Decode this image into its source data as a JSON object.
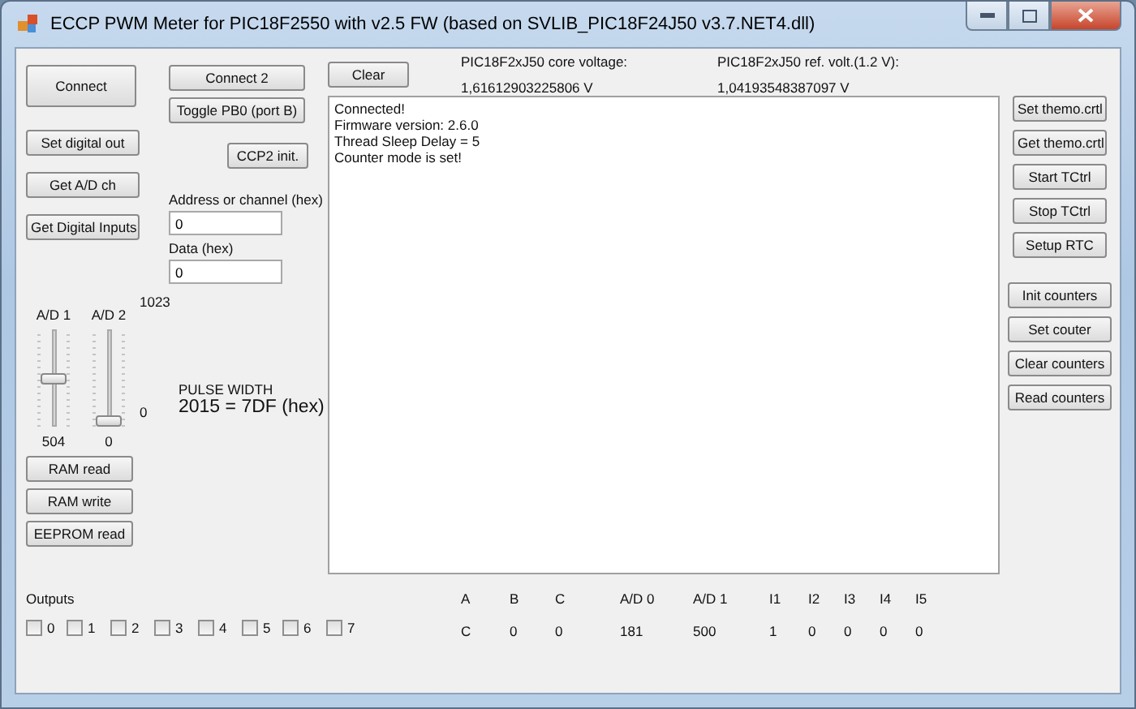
{
  "window": {
    "title": "ECCP PWM Meter for PIC18F2550 with v2.5 FW (based on SVLIB_PIC18F24J50 v3.7.NET4.dll)"
  },
  "left_buttons": [
    {
      "label": "Connect",
      "kind": "large"
    },
    {
      "label": "Set digital out",
      "kind": "small"
    },
    {
      "label": "Get A/D ch",
      "kind": "small"
    },
    {
      "label": "Get Digital Inputs",
      "kind": "small"
    }
  ],
  "middle_buttons": [
    {
      "label": "Connect 2"
    },
    {
      "label": "Toggle PB0 (port B)"
    },
    {
      "label": "CCP2 init."
    }
  ],
  "fields": [
    {
      "label": "Address or channel (hex)",
      "value": "0"
    },
    {
      "label": "Data (hex)",
      "value": "0"
    }
  ],
  "sliders": [
    {
      "label": "A/D 1",
      "level": 0.49,
      "reading": "504"
    },
    {
      "label": "A/D 2",
      "level": 0,
      "reading": "0"
    }
  ],
  "slider_scale": {
    "max": "1023",
    "min": "0"
  },
  "pulse_width": {
    "label": "PULSE WIDTH",
    "value": "2015 = 7DF (hex)"
  },
  "memory_buttons": [
    {
      "label": "RAM read"
    },
    {
      "label": "RAM write"
    },
    {
      "label": "EEPROM read"
    }
  ],
  "clear_button": {
    "label": "Clear"
  },
  "voltages": [
    {
      "label": "PIC18F2xJ50 core voltage:",
      "value": "1,61612903225806 V"
    },
    {
      "label": "PIC18F2xJ50 ref. volt.(1.2 V):",
      "value": "1,04193548387097 V"
    }
  ],
  "log": [
    "Connected!",
    "Firmware version: 2.6.0",
    "Thread Sleep Delay = 5",
    "Counter mode is set!"
  ],
  "control_buttons": [
    {
      "label": "Set themo.crtl"
    },
    {
      "label": "Get themo.crtl"
    },
    {
      "label": "Start TCtrl"
    },
    {
      "label": "Stop TCtrl"
    },
    {
      "label": "Setup RTC"
    }
  ],
  "counter_buttons": [
    {
      "label": "Init counters"
    },
    {
      "label": "Set couter"
    },
    {
      "label": "Clear counters"
    },
    {
      "label": "Read counters"
    }
  ],
  "outputs": {
    "label": "Outputs",
    "items": [
      {
        "label": "0",
        "checked": false
      },
      {
        "label": "1",
        "checked": false
      },
      {
        "label": "2",
        "checked": false
      },
      {
        "label": "3",
        "checked": false
      },
      {
        "label": "4",
        "checked": false
      },
      {
        "label": "5",
        "checked": false
      },
      {
        "label": "6",
        "checked": false
      },
      {
        "label": "7",
        "checked": false
      }
    ]
  },
  "readouts": [
    {
      "header": "A",
      "value": "C"
    },
    {
      "header": "B",
      "value": "0"
    },
    {
      "header": "C",
      "value": "0"
    },
    {
      "header": "A/D 0",
      "value": "181"
    },
    {
      "header": "A/D 1",
      "value": "500"
    },
    {
      "header": "I1",
      "value": "1"
    },
    {
      "header": "I2",
      "value": "0"
    },
    {
      "header": "I3",
      "value": "0"
    },
    {
      "header": "I4",
      "value": "0"
    },
    {
      "header": "I5",
      "value": "0"
    }
  ]
}
